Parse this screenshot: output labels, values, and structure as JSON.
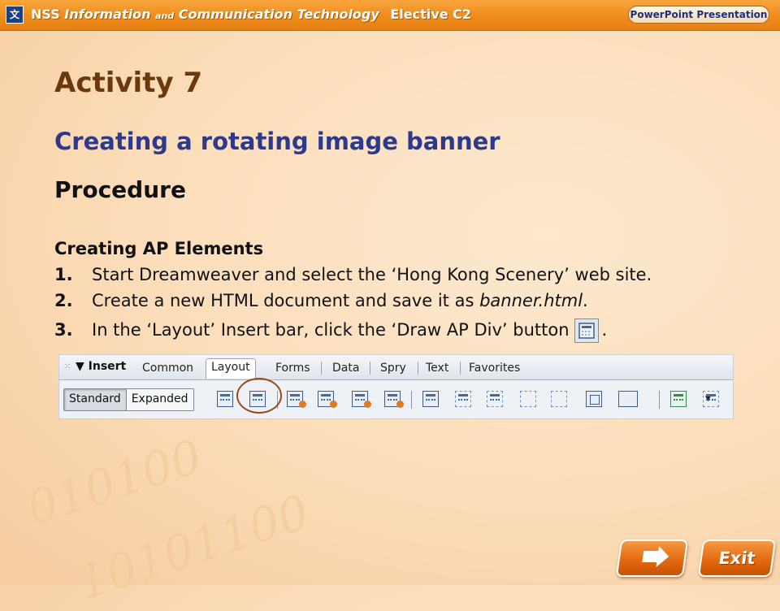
{
  "header": {
    "nss": "NSS",
    "title_part1": "Information",
    "title_and": "and",
    "title_part2": "Communication Technology",
    "elective": "Elective C2",
    "badge": "PowerPoint Presentation"
  },
  "slide": {
    "activity": "Activity 7",
    "subtitle": "Creating a rotating image banner",
    "procedure": "Procedure",
    "section": "Creating AP Elements",
    "steps": [
      {
        "num": "1.",
        "text": "Start Dreamweaver and select the ‘Hong Kong Scenery’ web site."
      },
      {
        "num": "2.",
        "text_before": "Create a new HTML document and save it as ",
        "italic": "banner.html",
        "text_after": "."
      },
      {
        "num": "3.",
        "text": "In the ‘Layout’ Insert bar, click the ‘Draw AP Div’ button",
        "text_after": "."
      }
    ]
  },
  "insert_bar": {
    "title": "▼ Insert",
    "tabs": [
      "Common",
      "Layout",
      "Forms",
      "Data",
      "Spry",
      "Text",
      "Favorites"
    ],
    "active_tab": "Layout",
    "modes": [
      "Standard",
      "Expanded"
    ],
    "pressed_mode": "Standard",
    "highlighted_tool": "draw-ap-div-icon"
  },
  "nav": {
    "next_icon": "right-arrow-icon",
    "exit_label": "Exit"
  },
  "colors": {
    "accent_orange": "#e57f12",
    "activity_brown": "#6b3a0c",
    "subtitle_blue": "#2d3a8c",
    "highlight_circle": "#9a4a1a"
  }
}
